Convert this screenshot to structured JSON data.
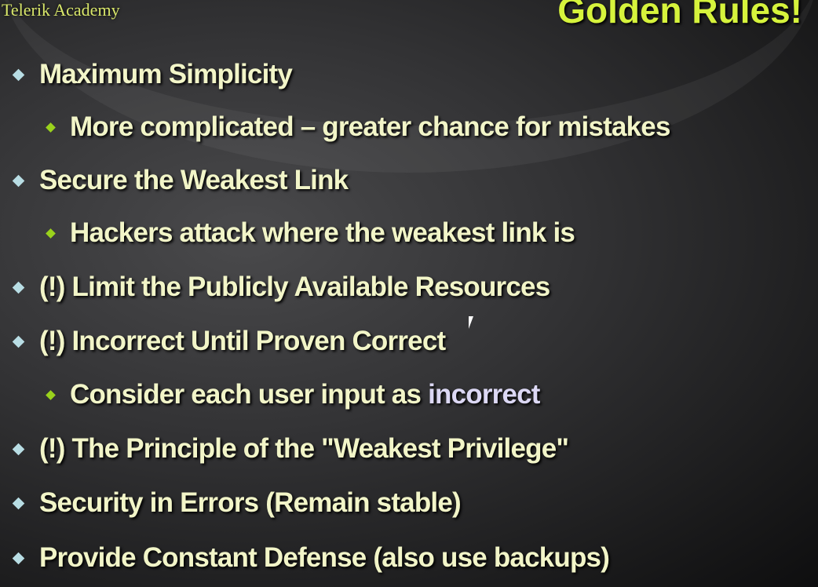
{
  "logo": "Telerik Academy",
  "title": "Golden Rules!",
  "colors": {
    "title": "#d6f33c",
    "text": "#f2f5c8",
    "bullet_level1": "#b8dde4",
    "bullet_level2": "#9ad21c",
    "highlight": "#dcd8f4"
  },
  "bullets": [
    {
      "level": 1,
      "text": "Maximum Simplicity"
    },
    {
      "level": 2,
      "text": "More complicated – greater chance for mistakes"
    },
    {
      "level": 1,
      "text": "Secure the Weakest Link"
    },
    {
      "level": 2,
      "text": "Hackers attack where the weakest link is"
    },
    {
      "level": 1,
      "text": "(!) Limit the Publicly Available Resources"
    },
    {
      "level": 1,
      "text": "(!) Incorrect Until Proven Correct"
    },
    {
      "level": 2,
      "text": "Consider each user input as ",
      "highlight": "incorrect"
    },
    {
      "level": 1,
      "text": "(!) The Principle of the \"Weakest Privilege\""
    },
    {
      "level": 1,
      "text": "Security in Errors (Remain stable)"
    },
    {
      "level": 1,
      "text": "Provide Constant Defense (also use backups)"
    }
  ]
}
